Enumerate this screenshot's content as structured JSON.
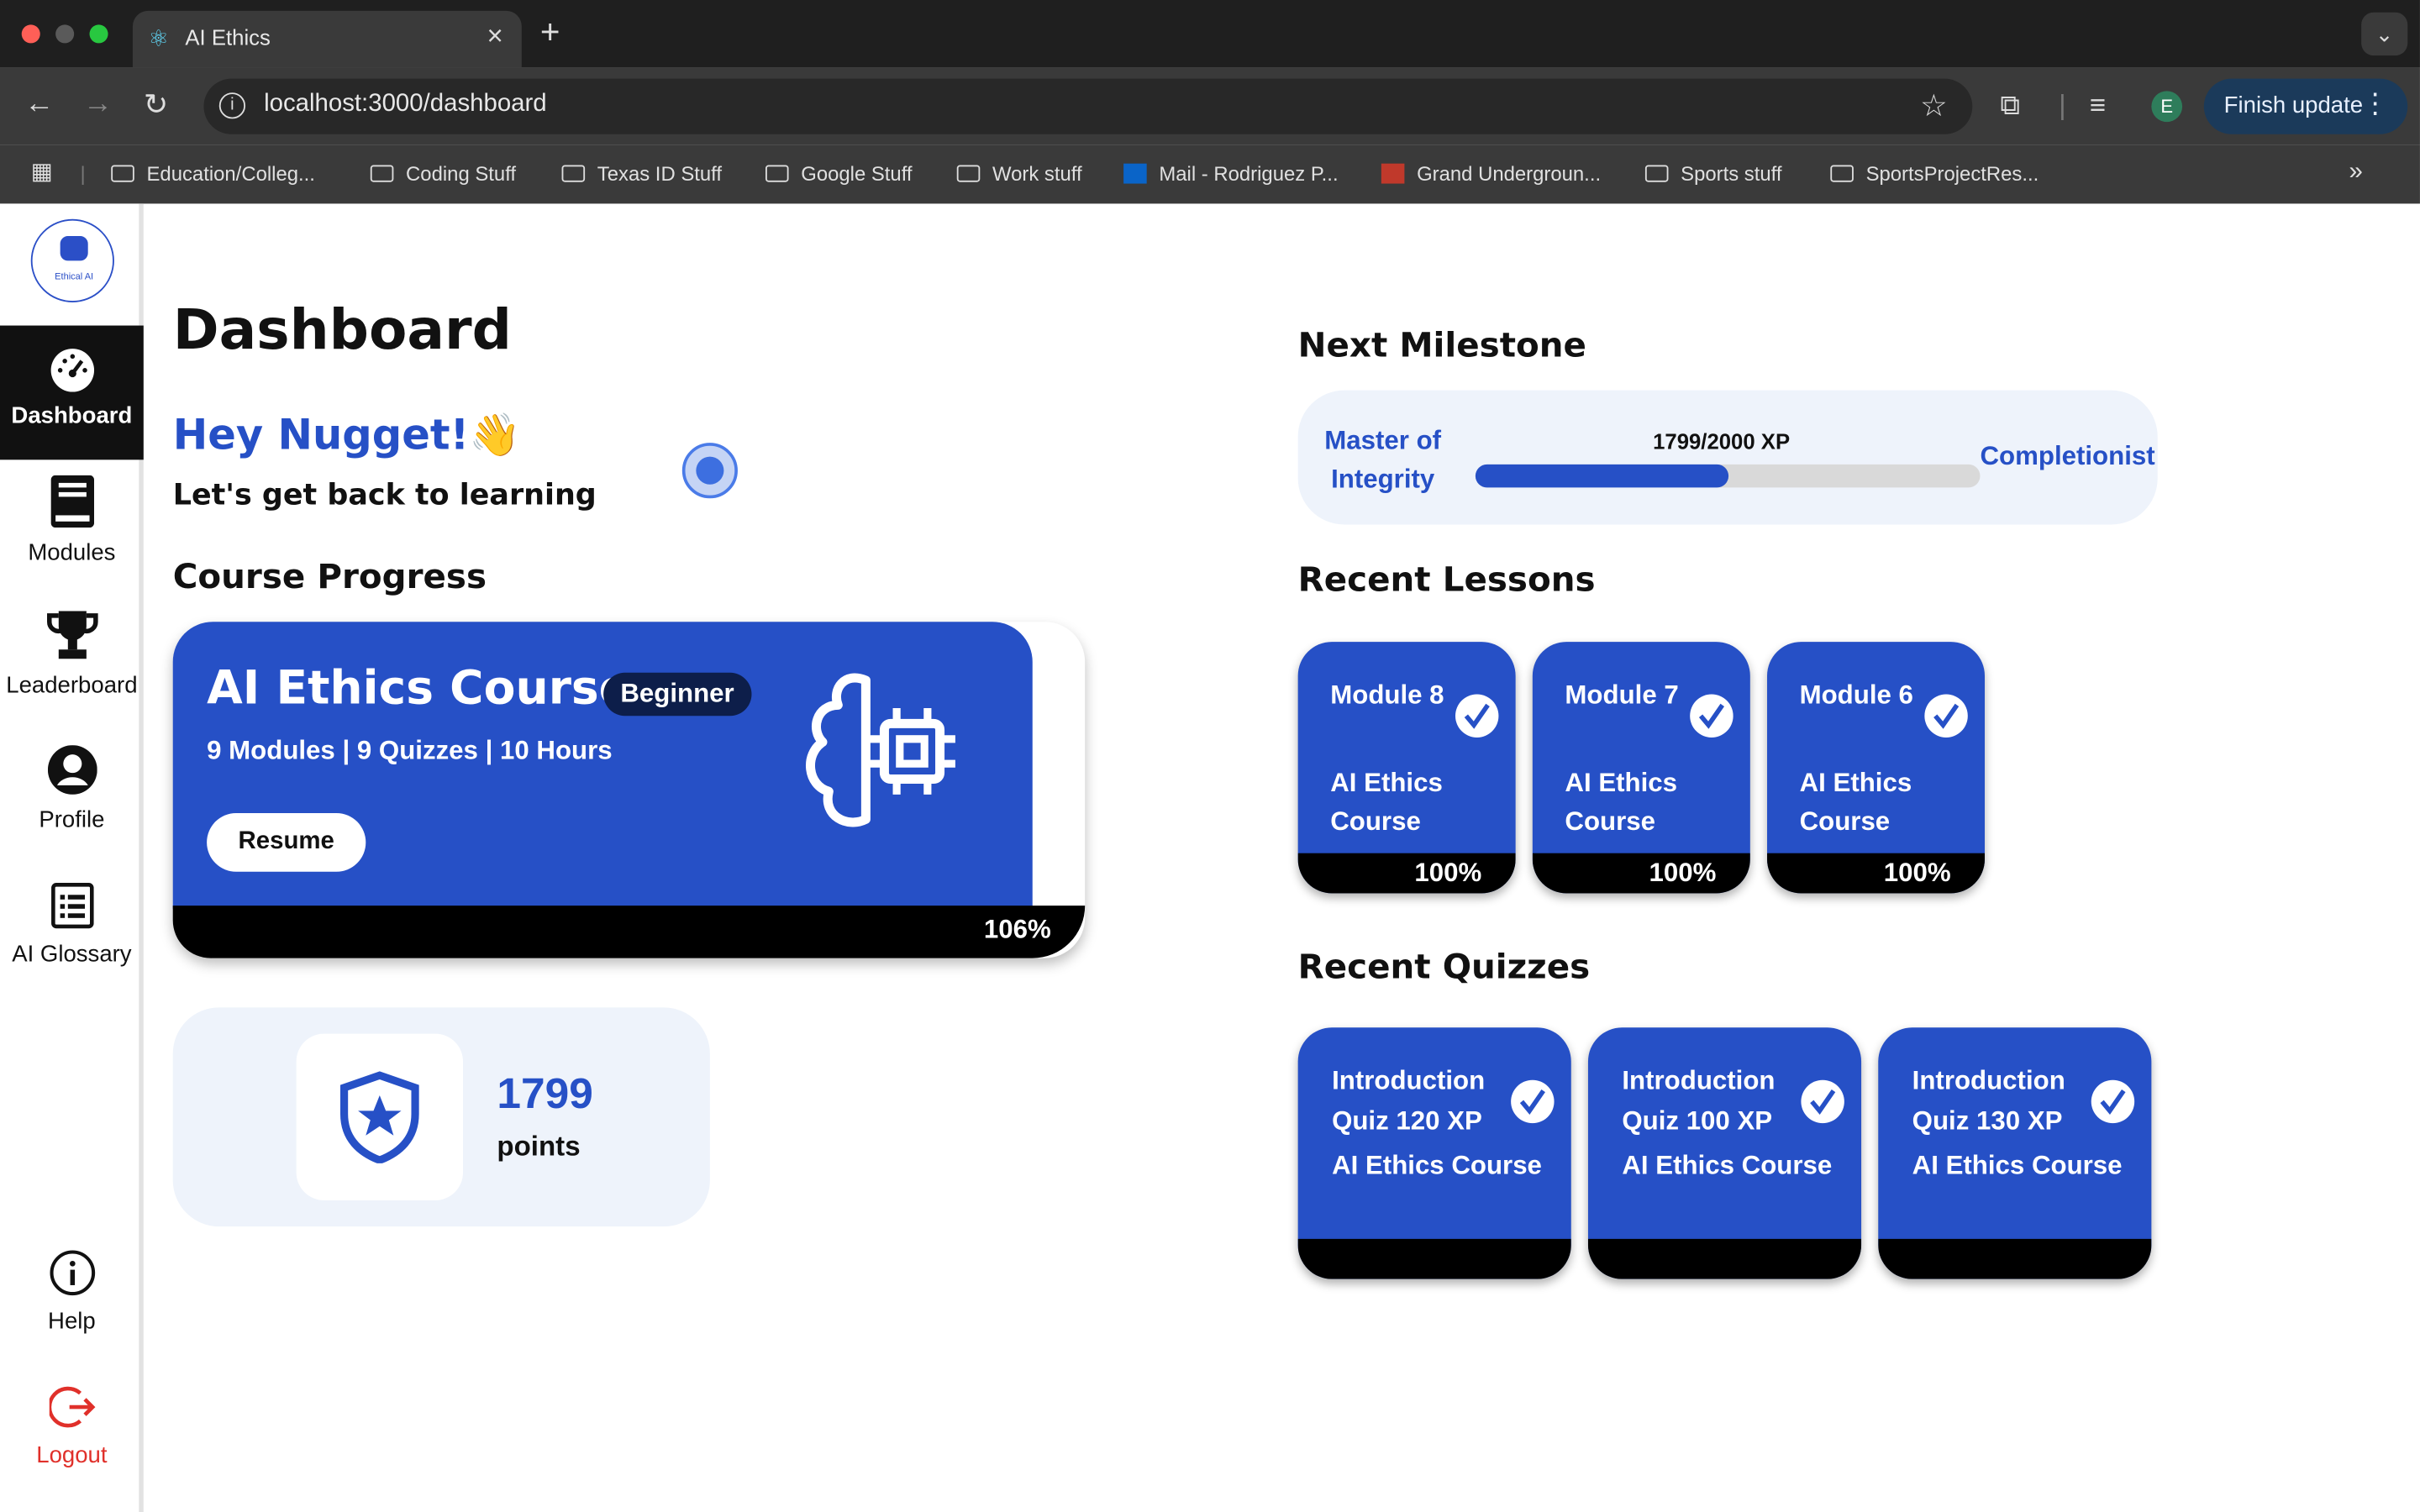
{
  "browser": {
    "tab_title": "AI Ethics",
    "url": "localhost:3000/dashboard",
    "profile_initial": "E",
    "finish_update": "Finish update",
    "bookmarks": [
      "Education/Colleg...",
      "Coding Stuff",
      "Texas ID Stuff",
      "Google Stuff",
      "Work stuff",
      "Mail - Rodriguez P...",
      "Grand Undergroun...",
      "Sports stuff",
      "SportsProjectRes..."
    ]
  },
  "sidebar": {
    "logo_text": "Ethical AI",
    "items": [
      {
        "label": "Dashboard",
        "icon": "speedometer-icon"
      },
      {
        "label": "Modules",
        "icon": "book-icon"
      },
      {
        "label": "Leaderboard",
        "icon": "trophy-icon"
      },
      {
        "label": "Profile",
        "icon": "user-icon"
      },
      {
        "label": "AI Glossary",
        "icon": "list-icon"
      },
      {
        "label": "Help",
        "icon": "info-icon"
      },
      {
        "label": "Logout",
        "icon": "logout-icon"
      }
    ]
  },
  "main": {
    "title": "Dashboard",
    "greeting": "Hey Nugget!👋",
    "subtitle": "Let's get back to learning",
    "course_progress_heading": "Course Progress",
    "course": {
      "title": "AI Ethics Course",
      "level": "Beginner",
      "meta": "9 Modules | 9 Quizzes | 10 Hours",
      "resume": "Resume",
      "progress": "106%"
    },
    "points": {
      "value": "1799",
      "label": "points"
    },
    "milestone": {
      "heading": "Next Milestone",
      "current": "Master of Integrity",
      "xp": "1799/2000 XP",
      "next": "Completionist",
      "fraction": 0.5
    },
    "recent_lessons_heading": "Recent Lessons",
    "lessons": [
      {
        "module": "Module 8",
        "course": "AI Ethics Course",
        "progress": "100%"
      },
      {
        "module": "Module 7",
        "course": "AI Ethics Course",
        "progress": "100%"
      },
      {
        "module": "Module 6",
        "course": "AI Ethics Course",
        "progress": "100%"
      }
    ],
    "recent_quizzes_heading": "Recent Quizzes",
    "quizzes": [
      {
        "title": "Introduction Quiz 120 XP",
        "course": "AI Ethics Course"
      },
      {
        "title": "Introduction Quiz 100 XP",
        "course": "AI Ethics Course"
      },
      {
        "title": "Introduction Quiz 130 XP",
        "course": "AI Ethics Course"
      }
    ]
  },
  "colors": {
    "accent": "#2650c6",
    "panel": "#eef3fb",
    "logout": "#e0302a"
  }
}
